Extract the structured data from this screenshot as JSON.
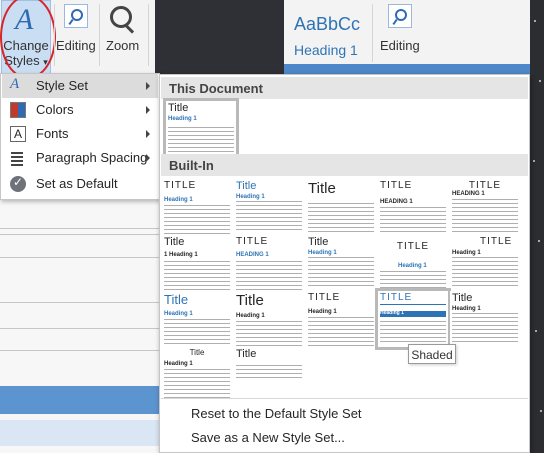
{
  "ribbon": {
    "change_styles_line1": "Change",
    "change_styles_line2": "Styles",
    "change_styles_caret": "▾",
    "editing_label_left": "Editing",
    "zoom_label": "Zoom",
    "style_sample_text": "AaBbCc",
    "style_sample_name": "Heading 1",
    "editing_label_right": "Editing"
  },
  "menu": {
    "items": [
      {
        "label": "Style Set",
        "icon": "style-set-icon",
        "has_submenu": true,
        "active": true
      },
      {
        "label": "Colors",
        "icon": "colors-icon",
        "has_submenu": true
      },
      {
        "label": "Fonts",
        "icon": "fonts-icon",
        "has_submenu": true
      },
      {
        "label": "Paragraph Spacing",
        "icon": "paragraph-spacing-icon",
        "has_submenu": true
      },
      {
        "label": "Set as Default",
        "icon": "checkmark-icon",
        "has_submenu": false
      }
    ]
  },
  "gallery": {
    "this_document_header": "This Document",
    "built_in_header": "Built-In",
    "current": {
      "title": "Title",
      "heading": "Heading 1"
    },
    "thumbs": [
      {
        "title": "TITLE",
        "heading": "Heading 1"
      },
      {
        "title": "Title",
        "heading": "Heading 1"
      },
      {
        "title": "Title",
        "heading": ""
      },
      {
        "title": "TITLE",
        "heading": "HEADING 1"
      },
      {
        "title": "TITLE",
        "heading": "HEADING 1"
      },
      {
        "title": "Title",
        "heading": "1   Heading 1"
      },
      {
        "title": "TITLE",
        "heading": "HEADING 1"
      },
      {
        "title": "Title",
        "heading": "Heading 1"
      },
      {
        "title": "TITLE",
        "heading": "Heading 1"
      },
      {
        "title": "TITLE",
        "heading": "Heading 1"
      },
      {
        "title": "Title",
        "heading": "Heading 1"
      },
      {
        "title": "Title",
        "heading": "Heading 1"
      },
      {
        "title": "TITLE",
        "heading": "Heading 1"
      },
      {
        "title": "TITLE",
        "heading": "Heading 1"
      },
      {
        "title": "Title",
        "heading": "Heading 1"
      },
      {
        "title": "Title",
        "heading": "Heading 1"
      },
      {
        "title": "Title",
        "heading": ""
      }
    ],
    "tooltip": "Shaded",
    "reset_label": "Reset to the Default Style Set",
    "save_label": "Save as a New Style Set...",
    "grip": "....."
  },
  "colors": {
    "accent_blue": "#2e74b5",
    "highlight": "#c9ddf3",
    "callout_red": "#d8252a"
  }
}
